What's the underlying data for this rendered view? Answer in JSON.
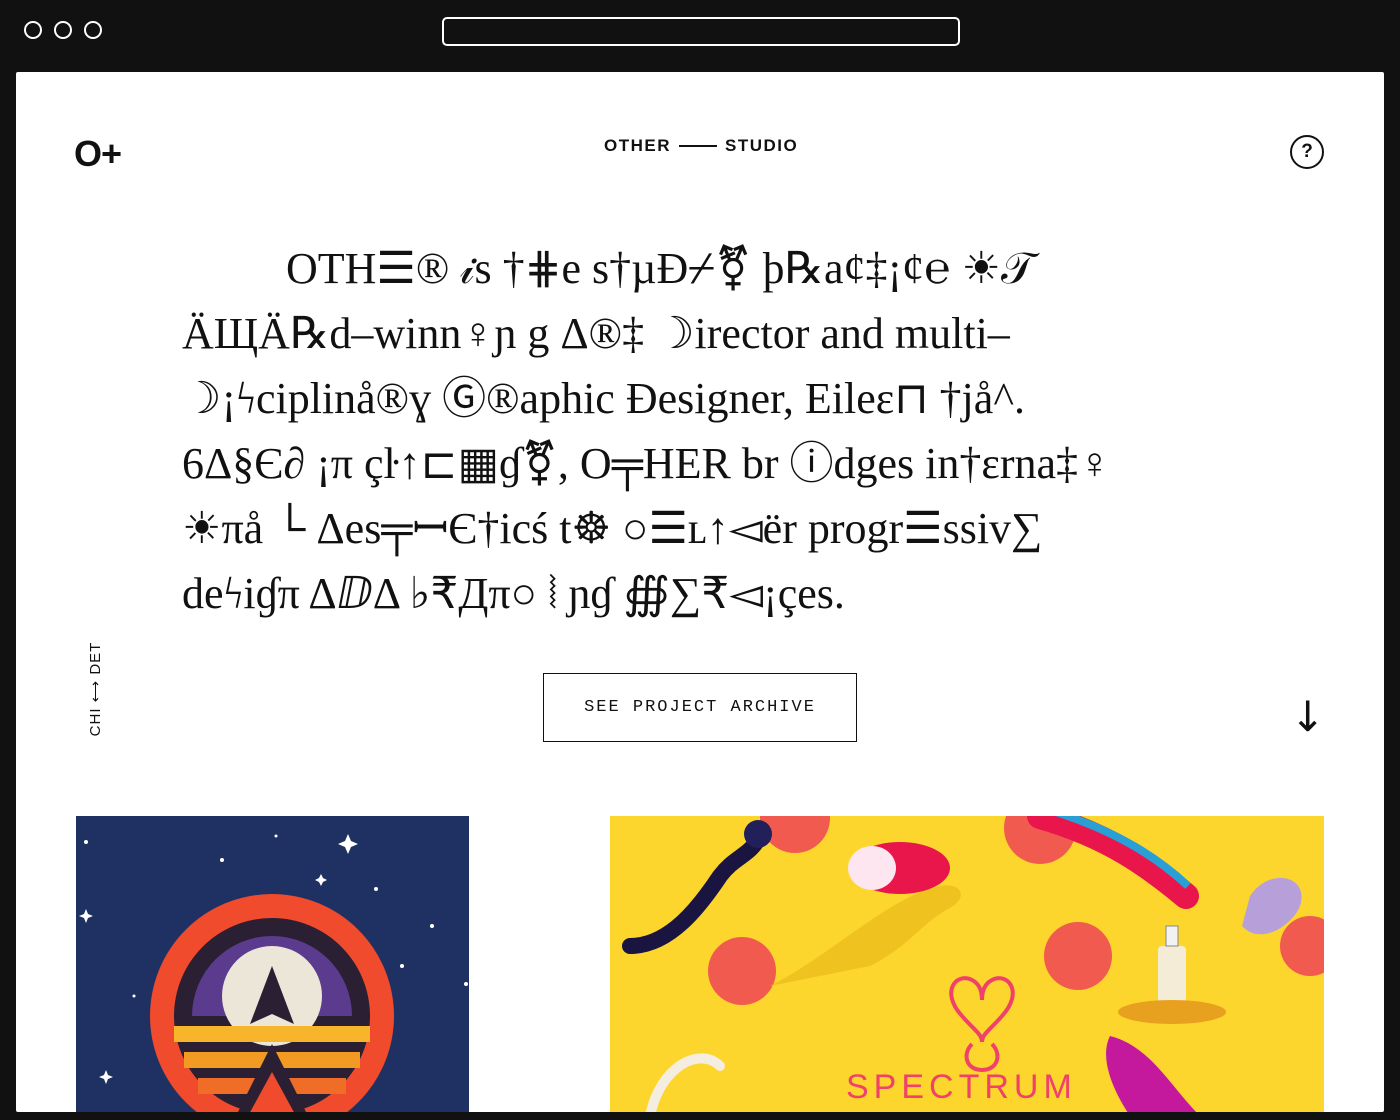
{
  "header": {
    "logo": "O+",
    "studio_left": "OTHER",
    "studio_right": "STUDIO",
    "help_symbol": "?"
  },
  "intro": {
    "lines": [
      "OTH☰® 𝒾s †⋕e s†µĐ⌿⚧ þ℞a¢‡¡¢℮ ☀𝒯",
      "ÄЩÄ℞d–winn♀ɲ g  Δ®‡ ☽irector and multi–",
      "☽¡ϟciplinå®ɣ Ⓖ®aphic Đesigner, Eileɛ⊓ †jå^.",
      "6Δ§Є∂ ¡π çŀ↑⊏▦ɠ⚧, O╤HER br ⓘdges in†ɛrna‡♀",
      "☀πå └ Δes╤ꟷЄ†icś t☸ ○☰ʟ↑◅ër progr☰ssiv∑",
      "deϟiɠπ ΔⅅΔ ♭₹Дπ○ ⦚ ɲɠ ∰∑₹◅¡çes."
    ]
  },
  "side_label": "CHI ⟷ DET",
  "archive_button": "SEE PROJECT ARCHIVE",
  "scroll_arrow": "↓",
  "projects": [
    {
      "title": ""
    },
    {
      "title": "SPECTRUM"
    }
  ],
  "colors": {
    "accent_pink": "#f0416a",
    "navy": "#1f3163",
    "yellow": "#fdd62d"
  }
}
